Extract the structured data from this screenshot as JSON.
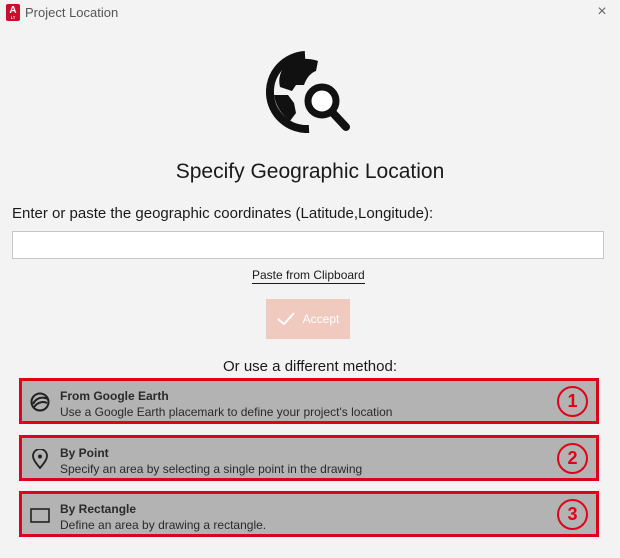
{
  "window": {
    "title": "Project Location",
    "app_icon_letter": "A",
    "app_icon_sub": "LT",
    "close_glyph": "×"
  },
  "main": {
    "heading": "Specify Geographic Location",
    "coord_label": "Enter or paste the geographic coordinates (Latitude,Longitude):",
    "coord_value": "",
    "paste_link": "Paste from Clipboard",
    "accept_label": "Accept",
    "accept_enabled": false,
    "alt_label": "Or use a different method:"
  },
  "methods": [
    {
      "title": "From Google Earth",
      "description": "Use a Google Earth placemark to define your project's location",
      "icon": "google-earth-icon",
      "badge": "1"
    },
    {
      "title": "By Point",
      "description": "Specify an area by selecting a single point in the drawing",
      "icon": "map-pin-icon",
      "badge": "2"
    },
    {
      "title": "By Rectangle",
      "description": "Define an area by drawing a rectangle.",
      "icon": "rectangle-icon",
      "badge": "3"
    }
  ],
  "colors": {
    "accept_disabled": "#f0c9bf",
    "method_bg": "#b3b3b3",
    "highlight": "#e0001a",
    "app_icon": "#c8102e"
  }
}
